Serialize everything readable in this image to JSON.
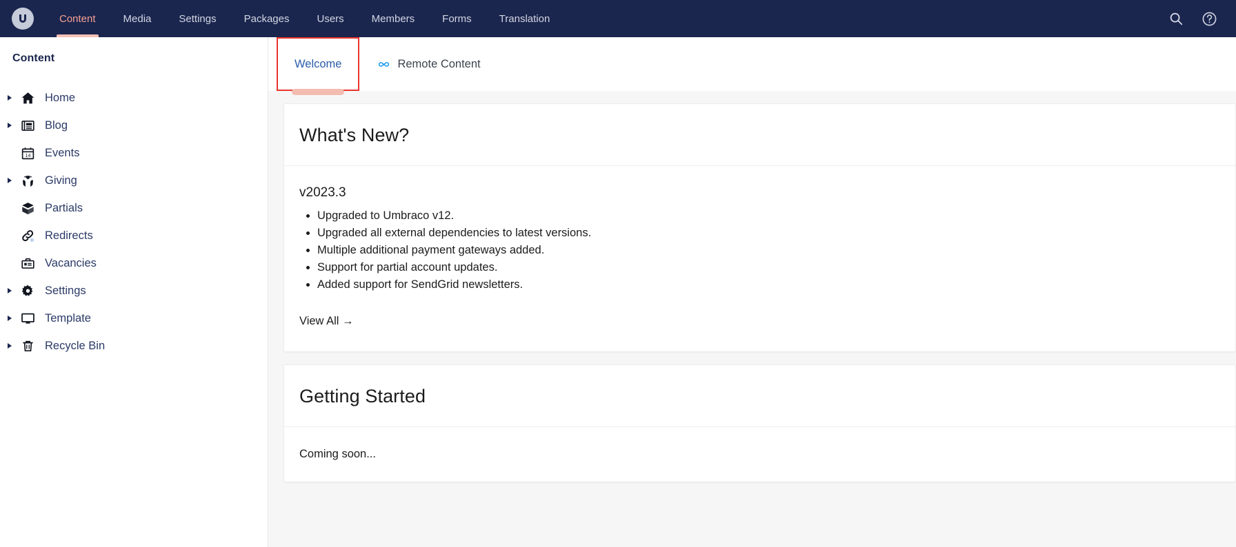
{
  "topbar": {
    "logo_name": "umbraco-logo",
    "nav_items": [
      {
        "label": "Content",
        "active": true
      },
      {
        "label": "Media",
        "active": false
      },
      {
        "label": "Settings",
        "active": false
      },
      {
        "label": "Packages",
        "active": false
      },
      {
        "label": "Users",
        "active": false
      },
      {
        "label": "Members",
        "active": false
      },
      {
        "label": "Forms",
        "active": false
      },
      {
        "label": "Translation",
        "active": false
      }
    ],
    "actions": [
      {
        "name": "search-icon",
        "label": "Search"
      },
      {
        "name": "help-icon",
        "label": "Help"
      }
    ],
    "background": "#1b264f",
    "active_color": "#f5a193"
  },
  "sidebar": {
    "title": "Content",
    "items": [
      {
        "label": "Home",
        "icon": "home-icon",
        "expandable": true
      },
      {
        "label": "Blog",
        "icon": "article-icon",
        "expandable": true
      },
      {
        "label": "Events",
        "icon": "calendar-icon",
        "expandable": false
      },
      {
        "label": "Giving",
        "icon": "hands-heart-icon",
        "expandable": true
      },
      {
        "label": "Partials",
        "icon": "box-icon",
        "expandable": false
      },
      {
        "label": "Redirects",
        "icon": "link-icon",
        "expandable": false
      },
      {
        "label": "Vacancies",
        "icon": "briefcase-icon",
        "expandable": false
      },
      {
        "label": "Settings",
        "icon": "gear-icon",
        "expandable": true
      },
      {
        "label": "Template",
        "icon": "monitor-icon",
        "expandable": true
      },
      {
        "label": "Recycle Bin",
        "icon": "trash-icon",
        "expandable": true
      }
    ]
  },
  "main": {
    "tabs": [
      {
        "label": "Welcome",
        "active": true,
        "highlighted": true,
        "icon": null
      },
      {
        "label": "Remote Content",
        "active": false,
        "highlighted": false,
        "icon": "infinity-icon"
      }
    ],
    "cards": [
      {
        "title": "What's New?",
        "version": "v2023.3",
        "items": [
          "Upgraded to Umbraco v12.",
          "Upgraded all external dependencies to latest versions.",
          "Multiple additional payment gateways added.",
          "Support for partial account updates.",
          "Added support for SendGrid newsletters."
        ],
        "link_label": "View All →"
      },
      {
        "title": "Getting Started",
        "body": "Coming soon..."
      }
    ]
  },
  "colors": {
    "nav_bg": "#1b264f",
    "accent_pink": "#f4bbb0",
    "highlight_red": "#e8352c",
    "tab_link_blue": "#2a5ca8",
    "icon_blue": "#1f9cf0",
    "page_bg": "#f6f6f7"
  }
}
